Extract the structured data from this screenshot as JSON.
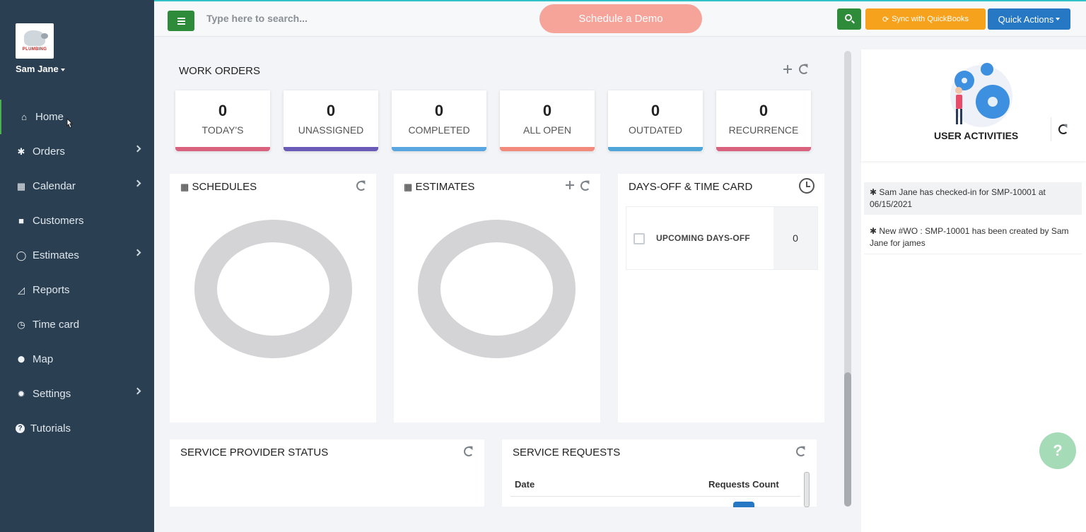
{
  "sidebar": {
    "logo_text": "PLUMBING",
    "user_name": "Sam Jane",
    "items": [
      {
        "label": "Home",
        "icon": "home-icon",
        "glyph": "⌂"
      },
      {
        "label": "Orders",
        "icon": "asterisk-icon",
        "glyph": "✱"
      },
      {
        "label": "Calendar",
        "icon": "calendar-icon",
        "glyph": "▦"
      },
      {
        "label": "Customers",
        "icon": "square-icon",
        "glyph": "■"
      },
      {
        "label": "Estimates",
        "icon": "circle-notch-icon",
        "glyph": "◯"
      },
      {
        "label": "Reports",
        "icon": "area-chart-icon",
        "glyph": "◿"
      },
      {
        "label": "Time card",
        "icon": "clock-icon",
        "glyph": "◷"
      },
      {
        "label": "Map",
        "icon": "map-marker-icon",
        "glyph": "⬤"
      },
      {
        "label": "Settings",
        "icon": "gear-icon",
        "glyph": "✹"
      },
      {
        "label": "Tutorials",
        "icon": "question-circle-icon",
        "glyph": "?"
      }
    ]
  },
  "topbar": {
    "search_placeholder": "Type here to search...",
    "demo_label": "Schedule a Demo",
    "sync_label": "Sync with QuickBooks",
    "quick_actions_label": "Quick Actions"
  },
  "work_orders": {
    "title": "WORK ORDERS",
    "cards": [
      {
        "value": "0",
        "label": "TODAY'S",
        "color": "#d9637f"
      },
      {
        "value": "0",
        "label": "UNASSIGNED",
        "color": "#6b5bb8"
      },
      {
        "value": "0",
        "label": "COMPLETED",
        "color": "#5aa6e0"
      },
      {
        "value": "0",
        "label": "ALL OPEN",
        "color": "#f28b7c"
      },
      {
        "value": "0",
        "label": "OUTDATED",
        "color": "#4fa5d8"
      },
      {
        "value": "0",
        "label": "RECURRENCE",
        "color": "#d9637f"
      }
    ]
  },
  "schedules": {
    "title": "SCHEDULES"
  },
  "estimates": {
    "title": "ESTIMATES"
  },
  "days_off": {
    "title": "DAYS-OFF & TIME CARD",
    "upcoming_label": "UPCOMING DAYS-OFF",
    "upcoming_count": "0"
  },
  "service_provider": {
    "title": "SERVICE PROVIDER STATUS"
  },
  "service_requests": {
    "title": "SERVICE REQUESTS",
    "col_date": "Date",
    "col_count": "Requests Count"
  },
  "user_activities": {
    "title": "USER ACTIVITIES",
    "items": [
      "✱ Sam Jane has checked-in for SMP-10001 at 06/15/2021",
      "✱ New #WO : SMP-10001 has been created by Sam Jane for james"
    ]
  },
  "help_label": "?"
}
